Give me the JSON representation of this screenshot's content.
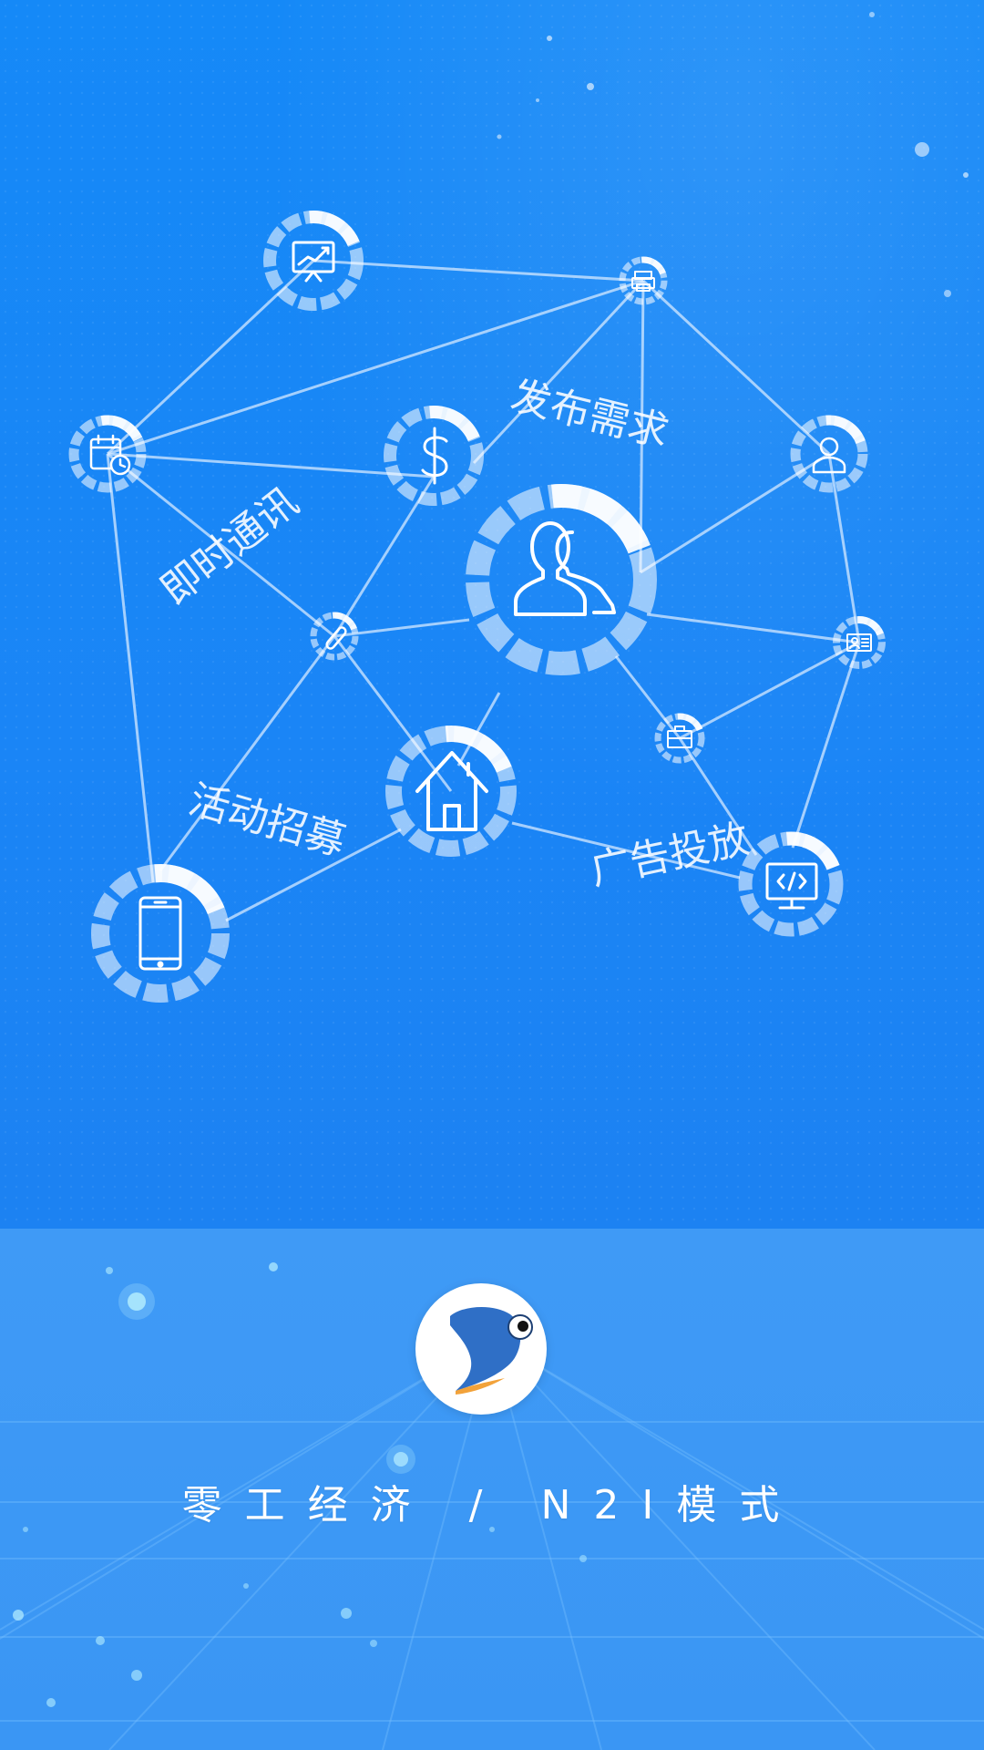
{
  "labels": {
    "publish": "发布需求",
    "instant": "即时通讯",
    "activity": "活动招募",
    "advert": "广告投放"
  },
  "tagline": "零工经济 / N2I模式",
  "colors": {
    "top_bg": "#1a85f6",
    "bottom_bg": "#3d98f5",
    "line": "#cfe6ff",
    "ring": "#ffffff",
    "logo_fish": "#2f6fc6",
    "logo_accent": "#f2a23a"
  },
  "icons": [
    "presentation-chart-icon",
    "printer-icon",
    "calendar-clock-icon",
    "dollar-icon",
    "user-icon",
    "users-icon",
    "paperclip-icon",
    "id-card-icon",
    "briefcase-icon",
    "home-icon",
    "smartphone-icon",
    "code-monitor-icon"
  ]
}
